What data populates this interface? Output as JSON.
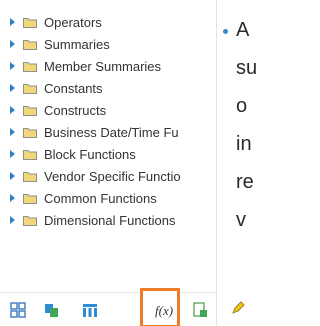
{
  "tree": {
    "items": [
      {
        "label": "Operators"
      },
      {
        "label": "Summaries"
      },
      {
        "label": "Member Summaries"
      },
      {
        "label": "Constants"
      },
      {
        "label": "Constructs"
      },
      {
        "label": "Business Date/Time Fu"
      },
      {
        "label": "Block Functions"
      },
      {
        "label": "Vendor Specific Functio"
      },
      {
        "label": "Common Functions"
      },
      {
        "label": "Dimensional Functions"
      }
    ]
  },
  "toolbar": {
    "function_label": "f(x)",
    "icons": [
      "grid-icon",
      "chart-icon",
      "columns-icon",
      "function-icon",
      "report-icon",
      "edit-icon"
    ]
  },
  "slide": {
    "lines": [
      "A",
      "su",
      "o",
      "in",
      "re",
      "v"
    ]
  },
  "colors": {
    "caret": "#2f7fc8",
    "folder_fill": "#efd77a",
    "highlight": "#ee7a2a",
    "bullet": "#2e8bd6"
  }
}
